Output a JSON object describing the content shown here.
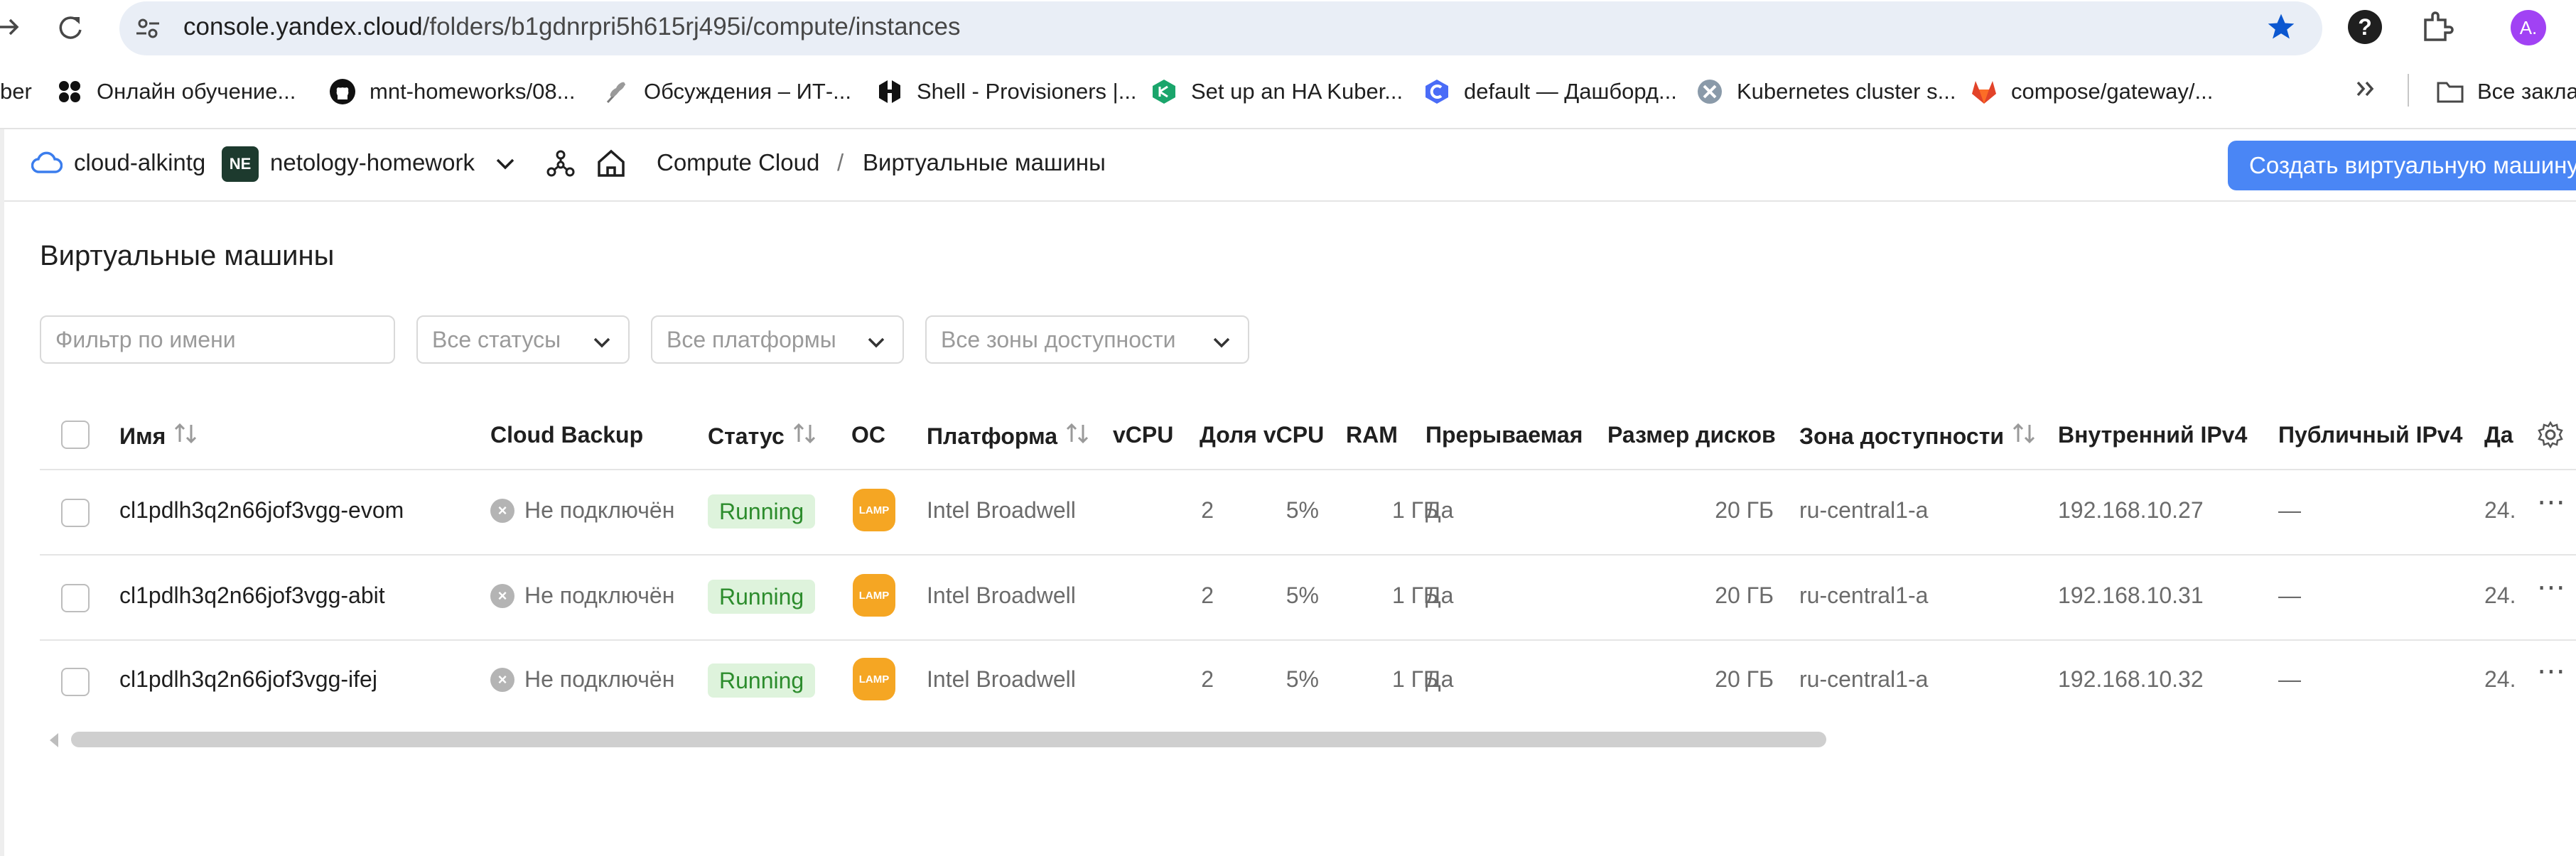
{
  "browser": {
    "url_host": "console.yandex.cloud",
    "url_path": "/folders/b1gdnrpri5h615rj495i/compute/instances",
    "avatar_letter": "A.",
    "bookmarks": [
      {
        "label": "ber"
      },
      {
        "label": "Онлайн обучение..."
      },
      {
        "label": "mnt-homeworks/08..."
      },
      {
        "label": "Обсуждения – ИТ-..."
      },
      {
        "label": "Shell - Provisioners |..."
      },
      {
        "label": "Set up an HA Kuber..."
      },
      {
        "label": "default — Дашборд..."
      },
      {
        "label": "Kubernetes cluster s..."
      },
      {
        "label": "compose/gateway/..."
      }
    ],
    "all_bookmarks": "Все заклад"
  },
  "header": {
    "cloud": "cloud-alkintg",
    "folder_badge": "NE",
    "folder": "netology-homework",
    "breadcrumb_service": "Compute Cloud",
    "breadcrumb_sep": "/",
    "breadcrumb_current": "Виртуальные машины",
    "create_button": "Создать виртуальную машину"
  },
  "page": {
    "title": "Виртуальные машины",
    "filters": {
      "name_placeholder": "Фильтр по имени",
      "status": "Все статусы",
      "platform": "Все платформы",
      "zone": "Все зоны доступности"
    }
  },
  "table": {
    "columns": {
      "name": "Имя",
      "backup": "Cloud Backup",
      "status": "Статус",
      "os": "ОС",
      "platform": "Платформа",
      "vcpu": "vCPU",
      "vcpu_share": "Доля vCPU",
      "ram": "RAM",
      "preemptible": "Прерываемая",
      "disk": "Размер дисков",
      "zone": "Зона доступности",
      "ipv4_int": "Внутренний IPv4",
      "ipv4_pub": "Публичный IPv4",
      "date": "Да"
    },
    "rows": [
      {
        "name": "cl1pdlh3q2n66jof3vgg-evom",
        "backup": "Не подключён",
        "status": "Running",
        "os": "LAMP",
        "platform": "Intel Broadwell",
        "vcpu": "2",
        "vcpu_share": "5%",
        "ram": "1 ГБ",
        "preemptible": "Да",
        "disk": "20 ГБ",
        "zone": "ru-central1-a",
        "ipv4_int": "192.168.10.27",
        "ipv4_pub": "—",
        "date": "24."
      },
      {
        "name": "cl1pdlh3q2n66jof3vgg-abit",
        "backup": "Не подключён",
        "status": "Running",
        "os": "LAMP",
        "platform": "Intel Broadwell",
        "vcpu": "2",
        "vcpu_share": "5%",
        "ram": "1 ГБ",
        "preemptible": "Да",
        "disk": "20 ГБ",
        "zone": "ru-central1-a",
        "ipv4_int": "192.168.10.31",
        "ipv4_pub": "—",
        "date": "24."
      },
      {
        "name": "cl1pdlh3q2n66jof3vgg-ifej",
        "backup": "Не подключён",
        "status": "Running",
        "os": "LAMP",
        "platform": "Intel Broadwell",
        "vcpu": "2",
        "vcpu_share": "5%",
        "ram": "1 ГБ",
        "preemptible": "Да",
        "disk": "20 ГБ",
        "zone": "ru-central1-a",
        "ipv4_int": "192.168.10.32",
        "ipv4_pub": "—",
        "date": "24."
      }
    ]
  },
  "colors": {
    "accent": "#4a86f5",
    "running_bg": "#def3dc",
    "running_text": "#2c8c2c",
    "lamp": "#f5a623"
  }
}
